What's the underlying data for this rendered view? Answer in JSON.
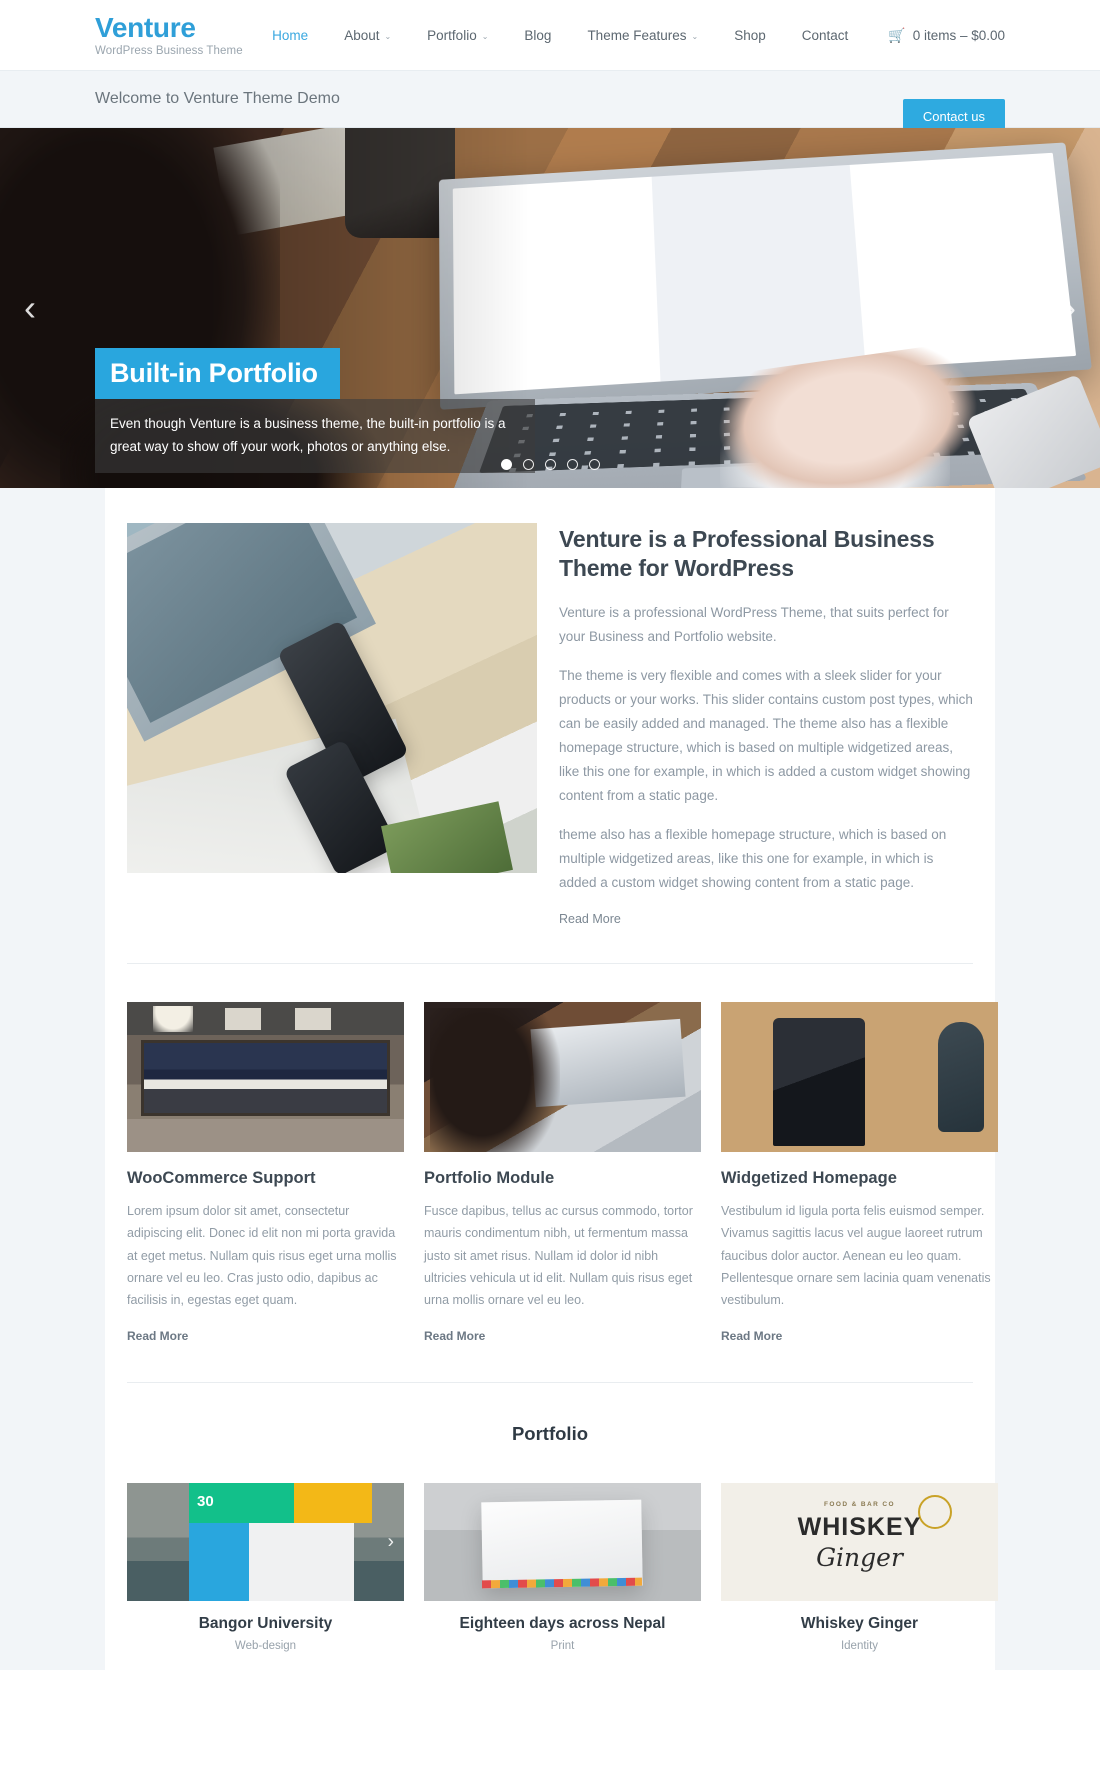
{
  "header": {
    "brand_title": "Venture",
    "brand_tagline": "WordPress Business Theme",
    "nav": [
      {
        "label": "Home",
        "caret": "",
        "active": true
      },
      {
        "label": "About",
        "caret": "⌄",
        "active": false
      },
      {
        "label": "Portfolio",
        "caret": "⌄",
        "active": false
      },
      {
        "label": "Blog",
        "caret": "",
        "active": false
      },
      {
        "label": "Theme Features",
        "caret": "⌄",
        "active": false
      },
      {
        "label": "Shop",
        "caret": "",
        "active": false
      },
      {
        "label": "Contact",
        "caret": "",
        "active": false
      }
    ],
    "cart": {
      "icon": "cart-icon",
      "glyph": "🛒",
      "label": "0 items – $0.00"
    },
    "accent_color": "#2f9fd8"
  },
  "welcome_bar": {
    "text": "Welcome to Venture Theme Demo",
    "button_label": "Contact us",
    "button_color": "#2eaae0",
    "background": "#f2f5f8"
  },
  "slider": {
    "title": "Built-in Portfolio",
    "description": "Even though Venture is a business theme, the built-in portfolio is a great way to show off your work, photos or anything else.",
    "prev_glyph": "‹",
    "next_glyph": "›",
    "title_bg": "#29a6de",
    "dots": [
      {
        "active": true
      },
      {
        "active": false
      },
      {
        "active": false
      },
      {
        "active": false
      },
      {
        "active": false
      }
    ]
  },
  "intro": {
    "title": "Venture is a Professional Business Theme for WordPress",
    "paragraphs": [
      "Venture is a professional WordPress Theme, that suits perfect for your Business and Portfolio website.",
      "The theme is very flexible and comes with a sleek slider for your products or your works. This slider contains custom post types, which can be easily added and managed. The theme also has a flexible homepage structure, which is based on multiple widgetized areas, like this one for example, in which is added a custom widget showing content from a static page.",
      "theme also has a flexible homepage structure, which is based on multiple widgetized areas, like this one for example, in which is added a custom widget showing content from a static page."
    ],
    "read_more": "Read More"
  },
  "features": [
    {
      "title": "WooCommerce Support",
      "text": "Lorem ipsum dolor sit amet, consectetur adipiscing elit. Donec id elit non mi porta gravida at eget metus. Nullam quis risus eget urna mollis ornare vel eu leo. Cras justo odio, dapibus ac facilisis in, egestas eget quam.",
      "read_more": "Read More"
    },
    {
      "title": "Portfolio Module",
      "text": "Fusce dapibus, tellus ac cursus commodo, tortor mauris condimentum nibh, ut fermentum massa justo sit amet risus. Nullam id dolor id nibh ultricies vehicula ut id elit. Nullam quis risus eget urna mollis ornare vel eu leo.",
      "read_more": "Read More"
    },
    {
      "title": "Widgetized Homepage",
      "text": "Vestibulum id ligula porta felis euismod semper. Vivamus sagittis lacus vel augue laoreet rutrum faucibus dolor auctor. Aenean eu leo quam. Pellentesque ornare sem lacinia quam venenatis vestibulum.",
      "read_more": "Read More"
    }
  ],
  "portfolio": {
    "section_title": "Portfolio",
    "items": [
      {
        "name": "Bangor University",
        "category": "Web-design",
        "badge": "30",
        "arrow": "›"
      },
      {
        "name": "Eighteen days across Nepal",
        "category": "Print"
      },
      {
        "name": "Whiskey Ginger",
        "category": "Identity",
        "art_top": "FOOD & BAR CO",
        "art_main": "WHISKEY",
        "art_sub": "Ginger"
      }
    ]
  }
}
